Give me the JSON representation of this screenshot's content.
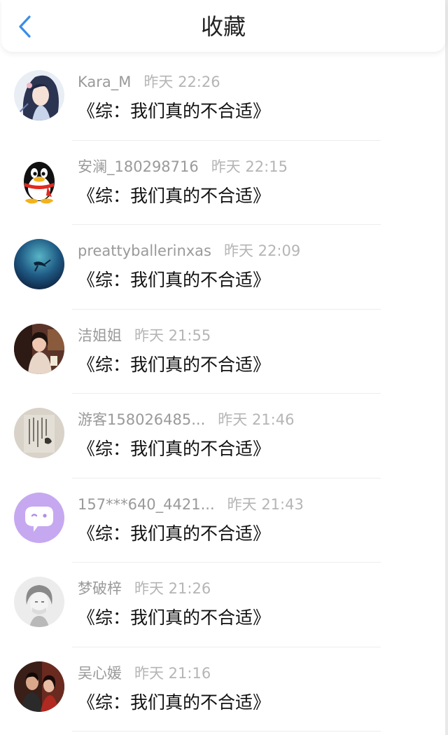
{
  "header": {
    "title": "收藏",
    "back_icon": "chevron-left-icon",
    "accent_color": "#3a8ee6"
  },
  "favorites": [
    {
      "user": "Kara_M",
      "time": "昨天 22:26",
      "book": "《综：我们真的不合适》",
      "avatar": "anime-girl-avatar"
    },
    {
      "user": "安澜_180298716",
      "time": "昨天 22:15",
      "book": "《综：我们真的不合适》",
      "avatar": "qq-penguin-avatar"
    },
    {
      "user": "preattyballerinxas",
      "time": "昨天 22:09",
      "book": "《综：我们真的不合适》",
      "avatar": "underwater-avatar"
    },
    {
      "user": "洁姐姐",
      "time": "昨天 21:55",
      "book": "《综：我们真的不合适》",
      "avatar": "photo-girl-avatar"
    },
    {
      "user": "游客158026485...",
      "time": "昨天 21:46",
      "book": "《综：我们真的不合适》",
      "avatar": "calligraphy-avatar"
    },
    {
      "user": "157***640_4421...",
      "time": "昨天 21:43",
      "book": "《综：我们真的不合适》",
      "avatar": "chat-bubble-avatar"
    },
    {
      "user": "梦破梓",
      "time": "昨天 21:26",
      "book": "《综：我们真的不合适》",
      "avatar": "sketch-boy-avatar"
    },
    {
      "user": "吴心媛",
      "time": "昨天 21:16",
      "book": "《综：我们真的不合适》",
      "avatar": "couple-photo-avatar"
    }
  ]
}
